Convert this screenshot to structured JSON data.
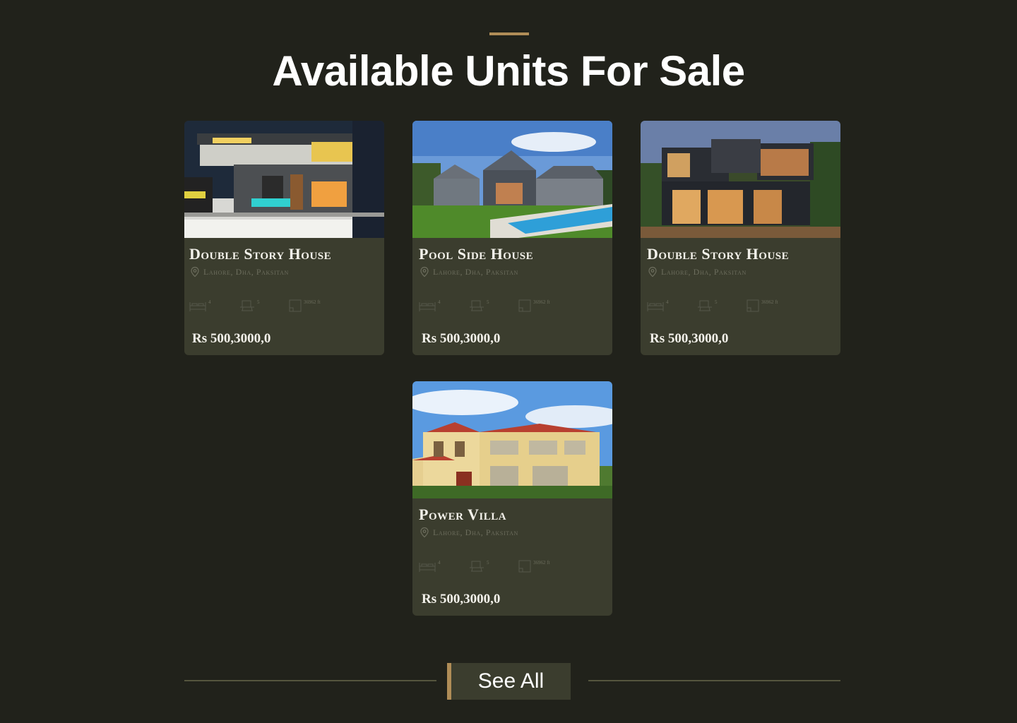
{
  "section": {
    "title": "Available Units For Sale",
    "accent_color": "#b08d57"
  },
  "listings": [
    {
      "title": "Double Story House",
      "location": "Lahore, Dha, Paksitan",
      "beds": "4",
      "baths": "5",
      "area": "36962 ft",
      "price": "Rs 500,3000,0",
      "image": "modern-double-story-house-night-photo"
    },
    {
      "title": "Pool Side House",
      "location": "Lahore, Dha, Paksitan",
      "beds": "4",
      "baths": "5",
      "area": "36962 ft",
      "price": "Rs 500,3000,0",
      "image": "grey-house-with-swimming-pool-photo"
    },
    {
      "title": "Double Story House",
      "location": "Lahore, Dha, Paksitan",
      "beds": "4",
      "baths": "5",
      "area": "36962 ft",
      "price": "Rs 500,3000,0",
      "image": "dark-modern-box-house-dusk-photo"
    },
    {
      "title": "Power Villa",
      "location": "Lahore, Dha, Paksitan",
      "beds": "4",
      "baths": "5",
      "area": "36962 ft",
      "price": "Rs 500,3000,0",
      "image": "cream-villa-red-roof-photo"
    }
  ],
  "icons": {
    "location": "map-pin-icon",
    "beds": "bed-icon",
    "baths": "bathtub-icon",
    "area": "area-icon"
  },
  "see_all": {
    "label": "See All"
  }
}
